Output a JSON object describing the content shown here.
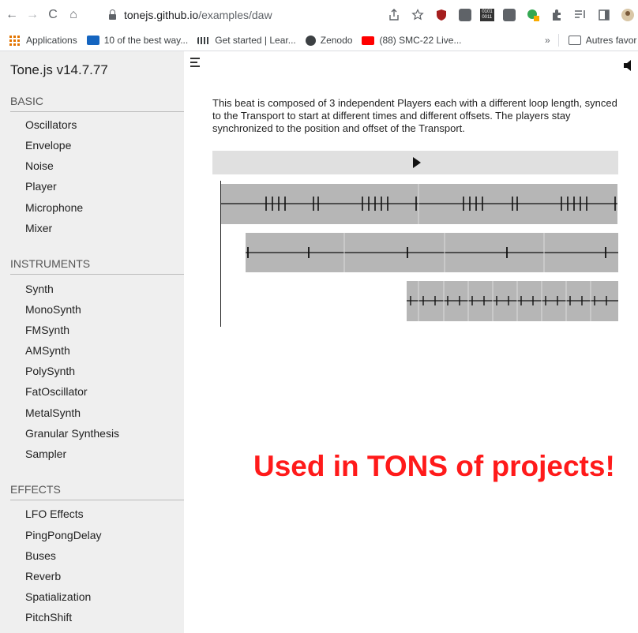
{
  "browser": {
    "nav": {
      "back": "←",
      "forward": "→",
      "reload": "C",
      "home": "⌂"
    },
    "url": {
      "host": "tonejs.github.io",
      "path": "/examples/daw"
    },
    "ext_text": {
      "counter": "0101\n0011"
    },
    "bookmarks": [
      {
        "label": "Applications"
      },
      {
        "label": "10 of the best way..."
      },
      {
        "label": "Get started | Lear..."
      },
      {
        "label": "Zenodo"
      },
      {
        "label": "(88) SMC-22 Live..."
      }
    ],
    "more": "»",
    "other_bookmarks": "Autres favor"
  },
  "sidebar": {
    "brand": "Tone.js v14.7.77",
    "sections": [
      {
        "title": "BASIC",
        "items": [
          "Oscillators",
          "Envelope",
          "Noise",
          "Player",
          "Microphone",
          "Mixer"
        ]
      },
      {
        "title": "INSTRUMENTS",
        "items": [
          "Synth",
          "MonoSynth",
          "FMSynth",
          "AMSynth",
          "PolySynth",
          "FatOscillator",
          "MetalSynth",
          "Granular Synthesis",
          "Sampler"
        ]
      },
      {
        "title": "EFFECTS",
        "items": [
          "LFO Effects",
          "PingPongDelay",
          "Buses",
          "Reverb",
          "Spatialization",
          "PitchShift"
        ]
      }
    ]
  },
  "main": {
    "description": "This beat is composed of 3 independent Players each with a different loop length, synced to the Transport to start at different times and different offsets. The players stay synchronized to the position and offset of the Transport.",
    "promo": "Used in TONS of projects!"
  },
  "colors": {
    "promo": "#ff1a1a",
    "track_bg": "#b6b6b6",
    "waveform": "#111111"
  },
  "icons": [
    "back-icon",
    "forward-icon",
    "reload-icon",
    "home-icon",
    "lock-icon",
    "share-icon",
    "star-icon",
    "menu-icon",
    "speaker-icon",
    "play-icon"
  ]
}
